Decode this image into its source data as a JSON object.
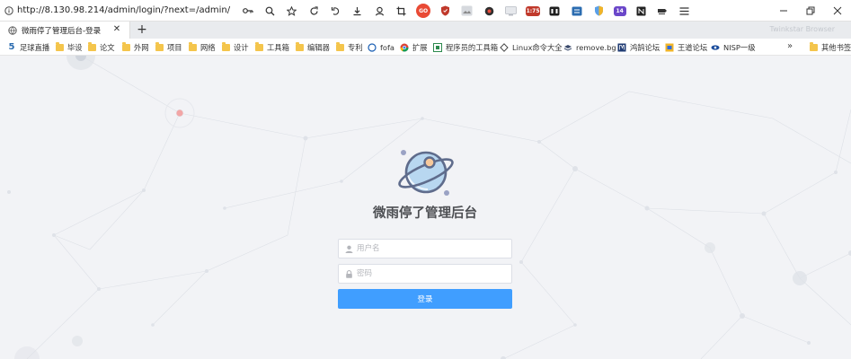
{
  "browser": {
    "url": "http://8.130.98.214/admin/login/?next=/admin/",
    "brand": "Twinkstar Browser",
    "tab": {
      "title": "微雨停了管理后台-登录"
    },
    "toolbar_icons": [
      {
        "name": "key-icon"
      },
      {
        "name": "zoom-icon"
      },
      {
        "name": "star-icon"
      },
      {
        "name": "refresh-icon"
      },
      {
        "name": "undo-icon"
      },
      {
        "name": "download-icon"
      },
      {
        "name": "user-icon"
      },
      {
        "name": "crop-icon"
      },
      {
        "name": "extension-icon"
      },
      {
        "name": "shield-icon"
      },
      {
        "name": "image-icon"
      },
      {
        "name": "record-icon"
      },
      {
        "name": "screen-icon"
      },
      {
        "name": "extension-icon"
      },
      {
        "name": "game-icon"
      },
      {
        "name": "sync-icon"
      },
      {
        "name": "shield-icon"
      },
      {
        "name": "extension-icon"
      },
      {
        "name": "notion-icon"
      },
      {
        "name": "extension-icon"
      },
      {
        "name": "menu-icon"
      }
    ],
    "toolbar_badges": {
      "b1": "1:75",
      "b2": "14"
    }
  },
  "bookmarks": {
    "items": [
      {
        "label": "足球直播",
        "icon": "5-icon"
      },
      {
        "label": "毕设",
        "icon": "folder-icon"
      },
      {
        "label": "论文",
        "icon": "folder-icon"
      },
      {
        "label": "外网",
        "icon": "folder-icon"
      },
      {
        "label": "项目",
        "icon": "folder-icon"
      },
      {
        "label": "网络",
        "icon": "folder-icon"
      },
      {
        "label": "设计",
        "icon": "folder-icon"
      },
      {
        "label": "工具箱",
        "icon": "folder-icon"
      },
      {
        "label": "编辑器",
        "icon": "folder-icon"
      },
      {
        "label": "专利",
        "icon": "folder-icon"
      },
      {
        "label": "fofa",
        "icon": "fofa-icon"
      },
      {
        "label": "扩展",
        "icon": "chrome-icon"
      },
      {
        "label": "程序员的工具箱",
        "icon": "toolbox-icon"
      },
      {
        "label": "Linux命令大全",
        "icon": "linux-icon"
      },
      {
        "label": "remove.bg",
        "icon": "removebg-icon"
      },
      {
        "label": "鸿鹄论坛",
        "icon": "forum-icon"
      },
      {
        "label": "王道论坛",
        "icon": "forum-icon"
      },
      {
        "label": "NISP一级",
        "icon": "nisp-icon"
      }
    ],
    "other": "其他书签"
  },
  "login": {
    "title": "微雨停了管理后台",
    "username_placeholder": "用户名",
    "password_placeholder": "密码",
    "submit_label": "登录"
  },
  "colors": {
    "primary": "#409eff",
    "background": "#f2f3f6",
    "planet": "#b8d7f0"
  }
}
